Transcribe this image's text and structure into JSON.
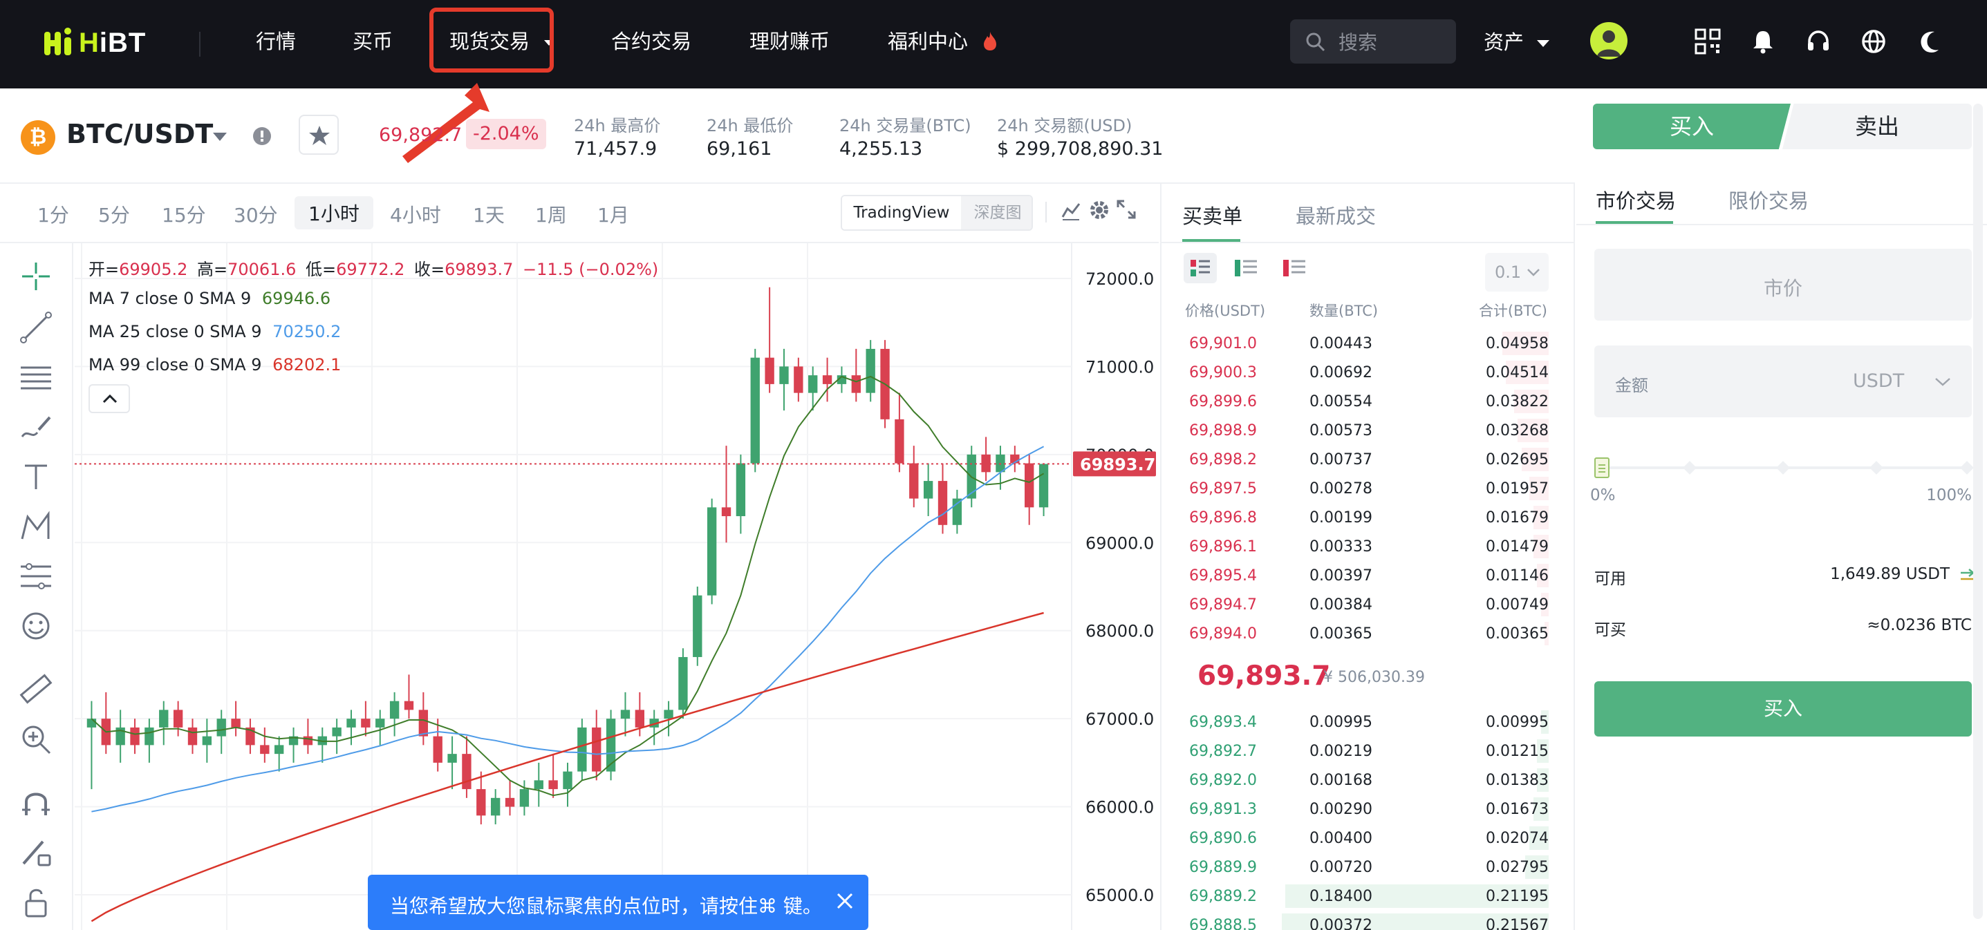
{
  "nav": {
    "logo_text_a": "H",
    "logo_text_b": "iBT",
    "items": [
      "行情",
      "买币",
      "现货交易",
      "合约交易",
      "理财赚币",
      "福利中心"
    ],
    "search_placeholder": "搜索",
    "assets_label": "资产",
    "icons": [
      "qr-code-icon",
      "bell-icon",
      "headset-icon",
      "globe-icon",
      "moon-icon"
    ],
    "highlight_color": "#e53b2b"
  },
  "ticker": {
    "pair": "BTC/USDT",
    "coin_symbol": "₿",
    "last_price": "69,892.7",
    "change": "-2.04%",
    "stats": [
      {
        "label": "24h 最高价",
        "value": "71,457.9"
      },
      {
        "label": "24h 最低价",
        "value": "69,161"
      },
      {
        "label": "24h 交易量(BTC)",
        "value": "4,255.13"
      },
      {
        "label": "24h 交易额(USD)",
        "value": "$ 299,708,890.31"
      }
    ]
  },
  "intervals": {
    "items": [
      "1分",
      "5分",
      "15分",
      "30分",
      "1小时",
      "4小时",
      "1天",
      "1周",
      "1月"
    ],
    "active": "1小时",
    "view_tradingview": "TradingView",
    "view_depth": "深度图"
  },
  "legend": {
    "ohlc_open_label": "开=",
    "ohlc_open": "69905.2",
    "ohlc_high_label": "高=",
    "ohlc_high": "70061.6",
    "ohlc_low_label": "低=",
    "ohlc_low": "69772.2",
    "ohlc_close_label": "收=",
    "ohlc_close": "69893.7",
    "ohlc_change": "−11.5 (−0.02%)",
    "ma7_label": "MA 7 close 0 SMA 9",
    "ma7_value": "69946.6",
    "ma25_label": "MA 25 close 0 SMA 9",
    "ma25_value": "70250.2",
    "ma99_label": "MA 99 close 0 SMA 9",
    "ma99_value": "68202.1"
  },
  "chart_data": {
    "type": "candlestick",
    "price_axis_ticks": [
      "72000.0",
      "71000.0",
      "70000.0",
      "69000.0",
      "68000.0",
      "67000.0",
      "66000.0",
      "65000.0"
    ],
    "ylim": [
      64600,
      72400
    ],
    "last_price_marker": "69893.7",
    "colors": {
      "up": "#3fa36f",
      "down": "#d94150",
      "ma7": "#3f7d2a",
      "ma25": "#4e9be8",
      "ma99": "#d9352b"
    },
    "candles_approx": [
      [
        66900,
        67200,
        66200,
        67000
      ],
      [
        67000,
        67300,
        66600,
        66700
      ],
      [
        66700,
        67100,
        66500,
        66900
      ],
      [
        66900,
        67000,
        66600,
        66700
      ],
      [
        66700,
        67000,
        66500,
        66900
      ],
      [
        66900,
        67200,
        66700,
        67100
      ],
      [
        67100,
        67200,
        66800,
        66900
      ],
      [
        66900,
        67000,
        66600,
        66700
      ],
      [
        66700,
        67000,
        66500,
        66800
      ],
      [
        66800,
        67100,
        66600,
        67000
      ],
      [
        67000,
        67200,
        66800,
        66900
      ],
      [
        66900,
        67000,
        66600,
        66700
      ],
      [
        66700,
        66900,
        66500,
        66600
      ],
      [
        66600,
        66800,
        66400,
        66700
      ],
      [
        66700,
        66900,
        66500,
        66800
      ],
      [
        66800,
        67000,
        66600,
        66700
      ],
      [
        66700,
        66900,
        66500,
        66800
      ],
      [
        66800,
        67000,
        66600,
        66900
      ],
      [
        66900,
        67100,
        66700,
        67000
      ],
      [
        67000,
        67200,
        66800,
        66900
      ],
      [
        66900,
        67100,
        66700,
        67000
      ],
      [
        67000,
        67300,
        66800,
        67200
      ],
      [
        67200,
        67500,
        67000,
        67100
      ],
      [
        67100,
        67300,
        66700,
        66800
      ],
      [
        66800,
        67000,
        66400,
        66500
      ],
      [
        66500,
        66800,
        66200,
        66600
      ],
      [
        66600,
        66800,
        66100,
        66200
      ],
      [
        66200,
        66400,
        65800,
        65900
      ],
      [
        65900,
        66200,
        65800,
        66100
      ],
      [
        66100,
        66300,
        65900,
        66000
      ],
      [
        66000,
        66300,
        65900,
        66200
      ],
      [
        66200,
        66500,
        66000,
        66300
      ],
      [
        66300,
        66600,
        66100,
        66200
      ],
      [
        66200,
        66500,
        66000,
        66400
      ],
      [
        66400,
        67000,
        66300,
        66900
      ],
      [
        66900,
        67100,
        66300,
        66400
      ],
      [
        66400,
        67100,
        66300,
        67000
      ],
      [
        67000,
        67300,
        66800,
        67100
      ],
      [
        67100,
        67300,
        66800,
        66900
      ],
      [
        66900,
        67100,
        66700,
        67000
      ],
      [
        67000,
        67200,
        66800,
        67100
      ],
      [
        67100,
        67800,
        67000,
        67700
      ],
      [
        67700,
        68500,
        67600,
        68400
      ],
      [
        68400,
        69500,
        68300,
        69400
      ],
      [
        69400,
        70100,
        69000,
        69300
      ],
      [
        69300,
        70000,
        69100,
        69900
      ],
      [
        69900,
        71200,
        69800,
        71100
      ],
      [
        71100,
        71900,
        70700,
        70800
      ],
      [
        70800,
        71200,
        70500,
        71000
      ],
      [
        71000,
        71100,
        70600,
        70700
      ],
      [
        70700,
        71000,
        70500,
        70900
      ],
      [
        70900,
        71100,
        70600,
        70800
      ],
      [
        70800,
        71000,
        70700,
        70900
      ],
      [
        70900,
        71200,
        70600,
        70700
      ],
      [
        70700,
        71300,
        70600,
        71200
      ],
      [
        71200,
        71300,
        70300,
        70400
      ],
      [
        70400,
        70700,
        69800,
        69900
      ],
      [
        69900,
        70100,
        69400,
        69500
      ],
      [
        69500,
        69900,
        69300,
        69700
      ],
      [
        69700,
        69900,
        69100,
        69200
      ],
      [
        69200,
        69600,
        69100,
        69500
      ],
      [
        69500,
        70100,
        69400,
        70000
      ],
      [
        70000,
        70200,
        69700,
        69800
      ],
      [
        69800,
        70100,
        69600,
        70000
      ],
      [
        70000,
        70100,
        69800,
        69900
      ],
      [
        69900,
        70000,
        69200,
        69400
      ],
      [
        69400,
        69900,
        69300,
        69893.7
      ]
    ]
  },
  "orderbook": {
    "tab_book": "买卖单",
    "tab_trades": "最新成交",
    "precision": "0.1",
    "headers": [
      "价格(USDT)",
      "数量(BTC)",
      "合计(BTC)"
    ],
    "asks": [
      {
        "price": "69,901.0",
        "amount": "0.00443",
        "total": "0.04958",
        "depth": 0.12
      },
      {
        "price": "69,900.3",
        "amount": "0.00692",
        "total": "0.04514",
        "depth": 0.11
      },
      {
        "price": "69,899.6",
        "amount": "0.00554",
        "total": "0.03822",
        "depth": 0.09
      },
      {
        "price": "69,898.9",
        "amount": "0.00573",
        "total": "0.03268",
        "depth": 0.08
      },
      {
        "price": "69,898.2",
        "amount": "0.00737",
        "total": "0.02695",
        "depth": 0.07
      },
      {
        "price": "69,897.5",
        "amount": "0.00278",
        "total": "0.01957",
        "depth": 0.05
      },
      {
        "price": "69,896.8",
        "amount": "0.00199",
        "total": "0.01679",
        "depth": 0.04
      },
      {
        "price": "69,896.1",
        "amount": "0.00333",
        "total": "0.01479",
        "depth": 0.04
      },
      {
        "price": "69,895.4",
        "amount": "0.00397",
        "total": "0.01146",
        "depth": 0.03
      },
      {
        "price": "69,894.7",
        "amount": "0.00384",
        "total": "0.00749",
        "depth": 0.02
      },
      {
        "price": "69,894.0",
        "amount": "0.00365",
        "total": "0.00365",
        "depth": 0.01
      }
    ],
    "mid_price": "69,893.7",
    "mid_fiat": "¥ 506,030.39",
    "bids": [
      {
        "price": "69,893.4",
        "amount": "0.00995",
        "total": "0.00995",
        "depth": 0.02
      },
      {
        "price": "69,892.7",
        "amount": "0.00219",
        "total": "0.01215",
        "depth": 0.03
      },
      {
        "price": "69,892.0",
        "amount": "0.00168",
        "total": "0.01383",
        "depth": 0.03
      },
      {
        "price": "69,891.3",
        "amount": "0.00290",
        "total": "0.01673",
        "depth": 0.04
      },
      {
        "price": "69,890.6",
        "amount": "0.00400",
        "total": "0.02074",
        "depth": 0.05
      },
      {
        "price": "69,889.9",
        "amount": "0.00720",
        "total": "0.02795",
        "depth": 0.06
      },
      {
        "price": "69,889.2",
        "amount": "0.18400",
        "total": "0.21195",
        "depth": 0.68
      },
      {
        "price": "69,888.5",
        "amount": "0.00372",
        "total": "0.21567",
        "depth": 0.69
      }
    ]
  },
  "trade": {
    "buy_tab": "买入",
    "sell_tab": "卖出",
    "type_market": "市价交易",
    "type_limit": "限价交易",
    "price_placeholder": "市价",
    "amount_label": "金额",
    "amount_unit": "USDT",
    "slider_min": "0%",
    "slider_max": "100%",
    "slider_value": 0,
    "available_label": "可用",
    "available_value": "1,649.89 USDT",
    "can_buy_label": "可买",
    "can_buy_value": "≈0.0236 BTC",
    "buy_button": "买入"
  },
  "toast": {
    "message": "当您希望放大您鼠标聚焦的点位时，请按住⌘ 键。"
  }
}
